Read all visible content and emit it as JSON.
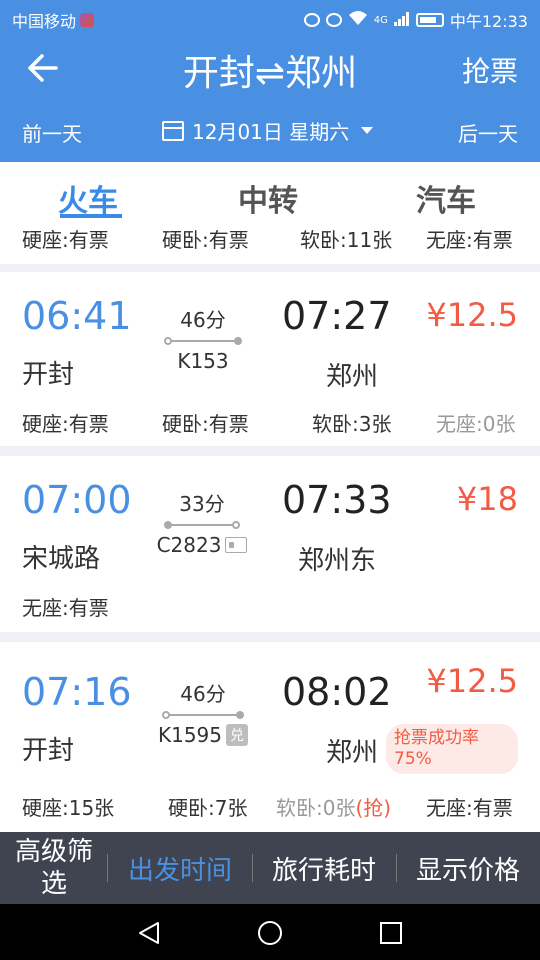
{
  "status": {
    "carrier": "中国移动",
    "net": "4G",
    "time": "中午12:33"
  },
  "header": {
    "title": "开封⇌郑州",
    "grab": "抢票",
    "prev_day": "前一天",
    "date": "12月01日 星期六",
    "next_day": "后一天"
  },
  "tabs": [
    {
      "label": "火车"
    },
    {
      "label": "中转"
    },
    {
      "label": "汽车"
    }
  ],
  "partial_row": {
    "s1": "硬座:有票",
    "s2": "硬卧:有票",
    "s3": "软卧:11张",
    "s4": "无座:有票"
  },
  "trains": [
    {
      "dep": "06:41",
      "duration": "46分",
      "no": "K153",
      "arr": "07:27",
      "price": "¥12.5",
      "from": "开封",
      "to": "郑州",
      "s1": "硬座:有票",
      "s2": "硬卧:有票",
      "s3": "软卧:3张",
      "s4": "无座:0张"
    },
    {
      "dep": "07:00",
      "duration": "33分",
      "no": "C2823",
      "arr": "07:33",
      "price": "¥18",
      "from": "宋城路",
      "to": "郑州东",
      "s1": "无座:有票"
    },
    {
      "dep": "07:16",
      "duration": "46分",
      "no": "K1595",
      "badge": "兑",
      "arr": "08:02",
      "price": "¥12.5",
      "from": "开封",
      "to": "郑州",
      "rate": "抢票成功率75%",
      "s1": "硬座:15张",
      "s2": "硬卧:7张",
      "s3": "软卧:0张",
      "s3_grab": "(抢)",
      "s4": "无座:有票"
    }
  ],
  "bottom": {
    "filter": "高级筛选",
    "dep_time": "出发时间",
    "travel_time": "旅行耗时",
    "price": "显示价格"
  },
  "colors": {
    "primary": "#4a90e2",
    "price": "#f25c45",
    "bottom_bar": "#3f4450"
  }
}
